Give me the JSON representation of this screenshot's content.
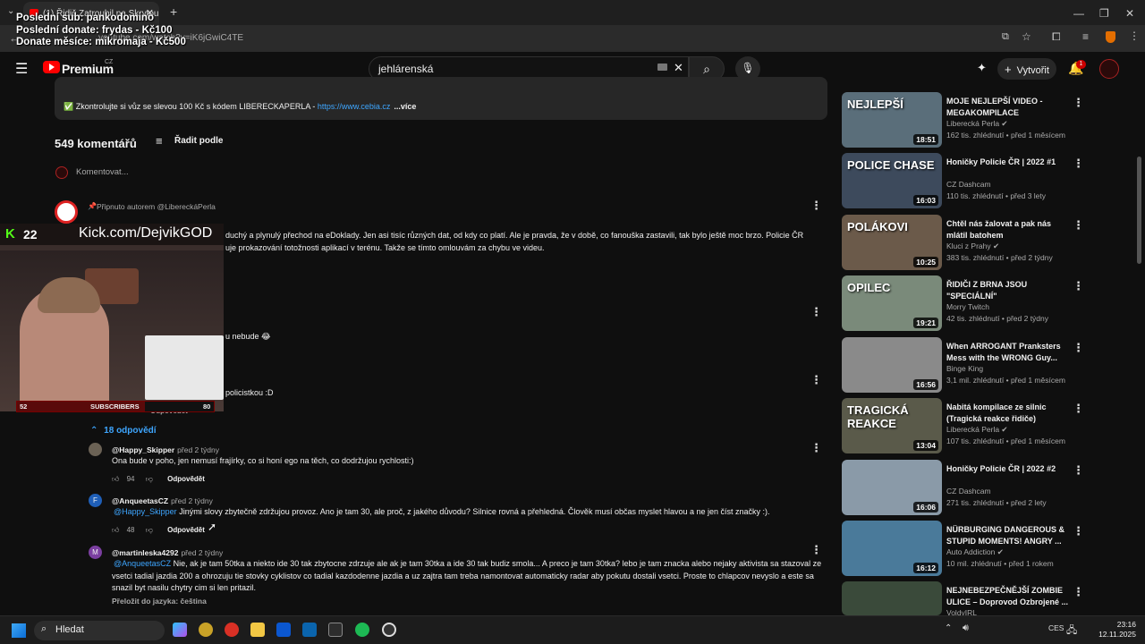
{
  "browser": {
    "tab_title": "(1) Řidič Zatroubil na Skrytou P",
    "url": "youtube.com/watch?v=iK6jGwiC4TE"
  },
  "overlay": {
    "line1": "Poslední sub: pankodomino",
    "line2": "Poslední donate: frydas - Kč100",
    "line3": "Donate měsíce: mikromaja - Kč500"
  },
  "header": {
    "logo_text": "Premium",
    "logo_region": "CZ",
    "search_value": "jehlárenská",
    "create_label": "Vytvořit",
    "notif_count": "1"
  },
  "description": {
    "line": "✅ Zkontrolujte si vůz se slevou 100 Kč s kódem LIBERECKAPERLA - ",
    "link": "https://www.cebia.cz",
    "more": "...více"
  },
  "comments_header": {
    "count": "549 komentářů",
    "sort_label": "Řadit podle",
    "add_placeholder": "Komentovat..."
  },
  "pinned": {
    "pin_label": "Připnuto autorem @LibereckáPerla",
    "text_line1": "duchý a plynulý přechod na eDoklady. Jen asi tisíc různých dat, od kdy co platí. Ale je pravda, že v době, co fanouška zastavili, tak bylo ještě moc brzo. Policie ČR",
    "text_line2": "uje prokazování totožnosti aplikací v terénu. Takže se tímto omlouvám za chybu ve videu."
  },
  "comment2": {
    "text": "u nebude 😂"
  },
  "comment3": {
    "text": "policistkou :D",
    "reply_label": "Odpovědět"
  },
  "replies_toggle": "18 odpovědí",
  "replies": [
    {
      "author": "@Happy_Skipper",
      "time": "před 2 týdny",
      "mention": "",
      "text": "Ona bude v poho, jen nemusí frajírky, co si honí ego na těch, co dodržujou rychlosti:)",
      "likes": "94",
      "reply_label": "Odpovědět"
    },
    {
      "author": "@AnqueetasCZ",
      "time": "před 2 týdny",
      "mention": "@Happy_Skipper",
      "text": " Jinými slovy zbytečně zdržujou provoz. Ano je tam 30, ale proč, z jakého důvodu? Silnice rovná a přehledná. Člověk musí občas myslet hlavou a ne jen číst značky :).",
      "likes": "48",
      "reply_label": "Odpovědět"
    },
    {
      "author": "@martinleska4292",
      "time": "před 2 týdny",
      "mention": "@AnqueetasCZ",
      "text": " Nie, ak je tam 50tka a niekto ide 30 tak zbytocne zdrzuje ale ak je tam 30tka a ide 30 tak budiz smola... A preco je tam 30tka? lebo je tam znacka alebo nejaky aktivista sa stazoval ze vsetci tadial jazdia 200 a ohrozuju tie stovky cyklistov co tadial kazdodenne jazdia a uz zajtra tam treba namontovat automaticky radar aby pokutu dostali vsetci. Proste to chlapcov nevyslo a este sa snazil byt nasilu chytry cim si len pritazil.",
      "translate": "Přeložit do jazyka: čeština"
    }
  ],
  "webcam": {
    "kick_count": "22",
    "kick_channel": "Kick.com/DejvikGOD",
    "sub_left": "52",
    "sub_label": "SUBSCRIBERS",
    "sub_right": "80"
  },
  "sidebar": [
    {
      "title": "MOJE NEJLEPŠÍ VIDEO - MEGAKOMPILACE",
      "channel": "Liberecká Perla",
      "verified": true,
      "meta": "162 tis. zhlédnutí • před 1 měsícem",
      "duration": "18:51",
      "caption": "NEJLEPŠÍ",
      "bg": "#5a6e7a"
    },
    {
      "title": "Honičky Policie ČR | 2022 #1",
      "channel": "CZ Dashcam",
      "verified": false,
      "meta": "110 tis. zhlédnutí • před 3 lety",
      "duration": "16:03",
      "caption": "POLICE CHASE",
      "bg": "#3d4a5c"
    },
    {
      "title": "Chtěl nás žalovat a pak nás mlátil batohem",
      "channel": "Kluci z Prahy",
      "verified": true,
      "meta": "383 tis. zhlédnutí • před 2 týdny",
      "duration": "10:25",
      "caption": "POLÁKOVI",
      "bg": "#6b5a4a"
    },
    {
      "title": "ŘIDIČI Z BRNA JSOU \"SPECIÁLNÍ\"",
      "channel": "Morry Twitch",
      "verified": false,
      "meta": "42 tis. zhlédnutí • před 2 týdny",
      "duration": "19:21",
      "caption": "OPILEC",
      "bg": "#7a8a7a"
    },
    {
      "title": "When ARROGANT Pranksters Mess with the WRONG Guy...",
      "channel": "Binge King",
      "verified": false,
      "meta": "3,1 mil. zhlédnutí • před 1 měsícem",
      "duration": "16:56",
      "caption": "",
      "bg": "#8a8a8a"
    },
    {
      "title": "Nabitá kompilace ze silnic (Tragická reakce řidiče)",
      "channel": "Liberecká Perla",
      "verified": true,
      "meta": "107 tis. zhlédnutí • před 1 měsícem",
      "duration": "13:04",
      "caption": "TRAGICKÁ REAKCE",
      "bg": "#5a5a4a"
    },
    {
      "title": "Honičky Policie ČR | 2022 #2",
      "channel": "CZ Dashcam",
      "verified": false,
      "meta": "271 tis. zhlédnutí • před 2 lety",
      "duration": "16:06",
      "caption": "",
      "bg": "#8a9aa8"
    },
    {
      "title": "NÜRBURGING DANGEROUS & STUPID MOMENTS! ANGRY ...",
      "channel": "Auto Addiction",
      "verified": true,
      "meta": "10 mil. zhlédnutí • před 1 rokem",
      "duration": "16:12",
      "caption": "",
      "bg": "#4a7a9a"
    },
    {
      "title": "NEJNEBEZPEČNĚJŠÍ ZOMBIE ULICE – Doprovod Ozbrojené ...",
      "channel": "VoldyIRL",
      "verified": false,
      "meta": "",
      "duration": "",
      "caption": "",
      "bg": "#3a4a3a"
    }
  ],
  "taskbar": {
    "search_label": "Hledat",
    "lang": "CES",
    "time": "23:16",
    "date": "12.11.2025"
  }
}
